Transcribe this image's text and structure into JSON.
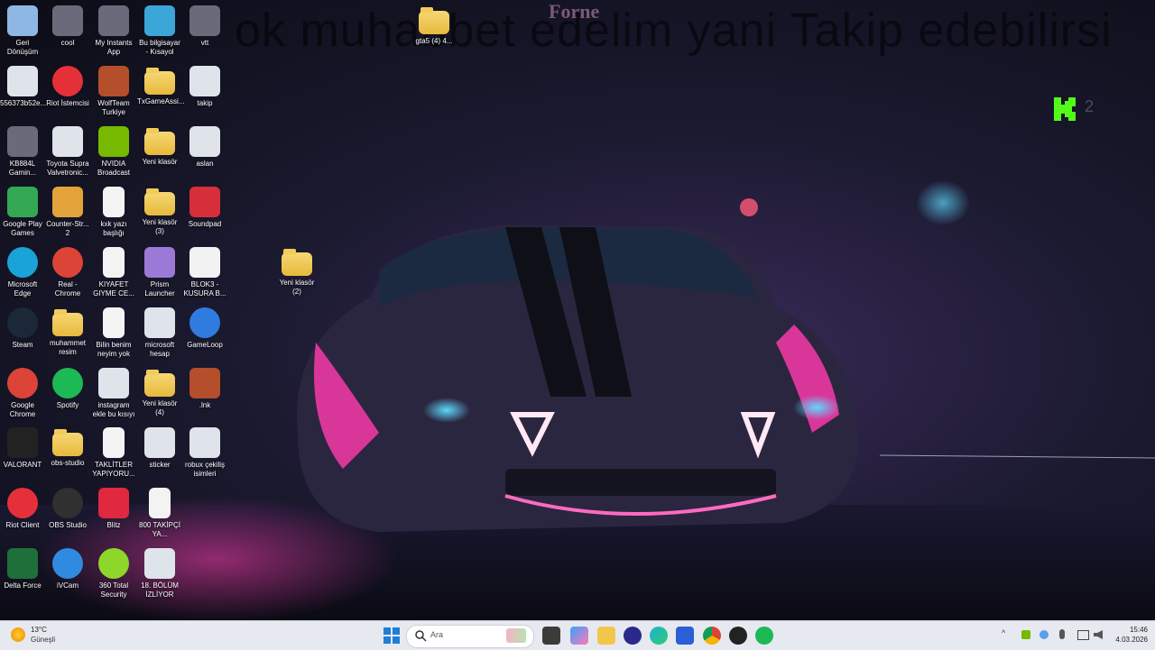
{
  "overlay": {
    "headline": "ok muhabbet edelim yani Takip edebilirsi",
    "brand": "Forne"
  },
  "desktop_icons": [
    {
      "label": "Geri Dönüşüm",
      "icon": "recycle-bin-icon"
    },
    {
      "label": "cool",
      "icon": "app-icon"
    },
    {
      "label": "My Instants App",
      "icon": "app-icon"
    },
    {
      "label": "Bu bilgisayar - Kısayol",
      "icon": "computer-icon"
    },
    {
      "label": "vtt",
      "icon": "app-icon"
    },
    {
      "label": "gta5 (4) 4...",
      "icon": "folder-icon"
    },
    {
      "label": "556373b52e...",
      "icon": "image-icon"
    },
    {
      "label": "Riot İstemcisi",
      "icon": "riot-icon"
    },
    {
      "label": "WolfTeam Turkiye",
      "icon": "game-icon"
    },
    {
      "label": "TxGameAssi...",
      "icon": "folder-icon"
    },
    {
      "label": "takip",
      "icon": "image-icon"
    },
    {
      "label": "KB884L Gamin...",
      "icon": "app-icon"
    },
    {
      "label": "Toyota Supra Valvetronic...",
      "icon": "image-icon"
    },
    {
      "label": "NVIDIA Broadcast",
      "icon": "nvidia-icon"
    },
    {
      "label": "Yeni klasör",
      "icon": "folder-icon"
    },
    {
      "label": "aslan",
      "icon": "image-icon"
    },
    {
      "label": "Google Play Games",
      "icon": "play-games-icon"
    },
    {
      "label": "Counter-Str... 2",
      "icon": "cs2-icon"
    },
    {
      "label": "kxk yazı başlığı",
      "icon": "document-icon"
    },
    {
      "label": "Yeni klasör (3)",
      "icon": "folder-icon"
    },
    {
      "label": "Soundpad",
      "icon": "soundpad-icon"
    },
    {
      "label": "Microsoft Edge",
      "icon": "edge-icon"
    },
    {
      "label": "Real - Chrome",
      "icon": "chrome-icon"
    },
    {
      "label": "KIYAFET GIYME CE...",
      "icon": "document-icon"
    },
    {
      "label": "Prism Launcher",
      "icon": "prism-icon"
    },
    {
      "label": "BLOK3 - KUSURA B...",
      "icon": "video-icon"
    },
    {
      "label": "Yeni klasör (2)",
      "icon": "folder-icon"
    },
    {
      "label": "Steam",
      "icon": "steam-icon"
    },
    {
      "label": "muhammet resim",
      "icon": "folder-icon"
    },
    {
      "label": "Bilin benim neyim yok",
      "icon": "document-icon"
    },
    {
      "label": "microsoft hesap",
      "icon": "image-icon"
    },
    {
      "label": "GameLoop",
      "icon": "gameloop-icon"
    },
    {
      "label": "Google Chrome",
      "icon": "chrome-icon"
    },
    {
      "label": "Spotify",
      "icon": "spotify-icon"
    },
    {
      "label": "instagram ekle bu kısıyı",
      "icon": "image-icon"
    },
    {
      "label": "Yeni klasör (4)",
      "icon": "folder-icon"
    },
    {
      "label": ".lnk",
      "icon": "game-icon"
    },
    {
      "label": "VALORANT",
      "icon": "valorant-icon"
    },
    {
      "label": "obs-studio",
      "icon": "folder-icon"
    },
    {
      "label": "TAKLİTLER YAPIYORU...",
      "icon": "document-icon"
    },
    {
      "label": "sticker",
      "icon": "image-icon"
    },
    {
      "label": "robux çekiliş isimleri",
      "icon": "image-icon"
    },
    {
      "label": "Riot Client",
      "icon": "riot-icon"
    },
    {
      "label": "OBS Studio",
      "icon": "obs-icon"
    },
    {
      "label": "Blitz",
      "icon": "blitz-icon"
    },
    {
      "label": "800 TAKİPÇİ YA...",
      "icon": "document-icon"
    },
    {
      "label": "Delta Force",
      "icon": "delta-force-icon"
    },
    {
      "label": "iVCam",
      "icon": "ivcam-icon"
    },
    {
      "label": "360 Total Security",
      "icon": "security-icon"
    },
    {
      "label": "18. BÖLÜM İZLİYOR",
      "icon": "image-icon"
    }
  ],
  "taskbar": {
    "weather_temp": "13°C",
    "weather_desc": "Güneşli",
    "search_placeholder": "Ara",
    "time": "15:46",
    "date": "4.03.2026"
  }
}
